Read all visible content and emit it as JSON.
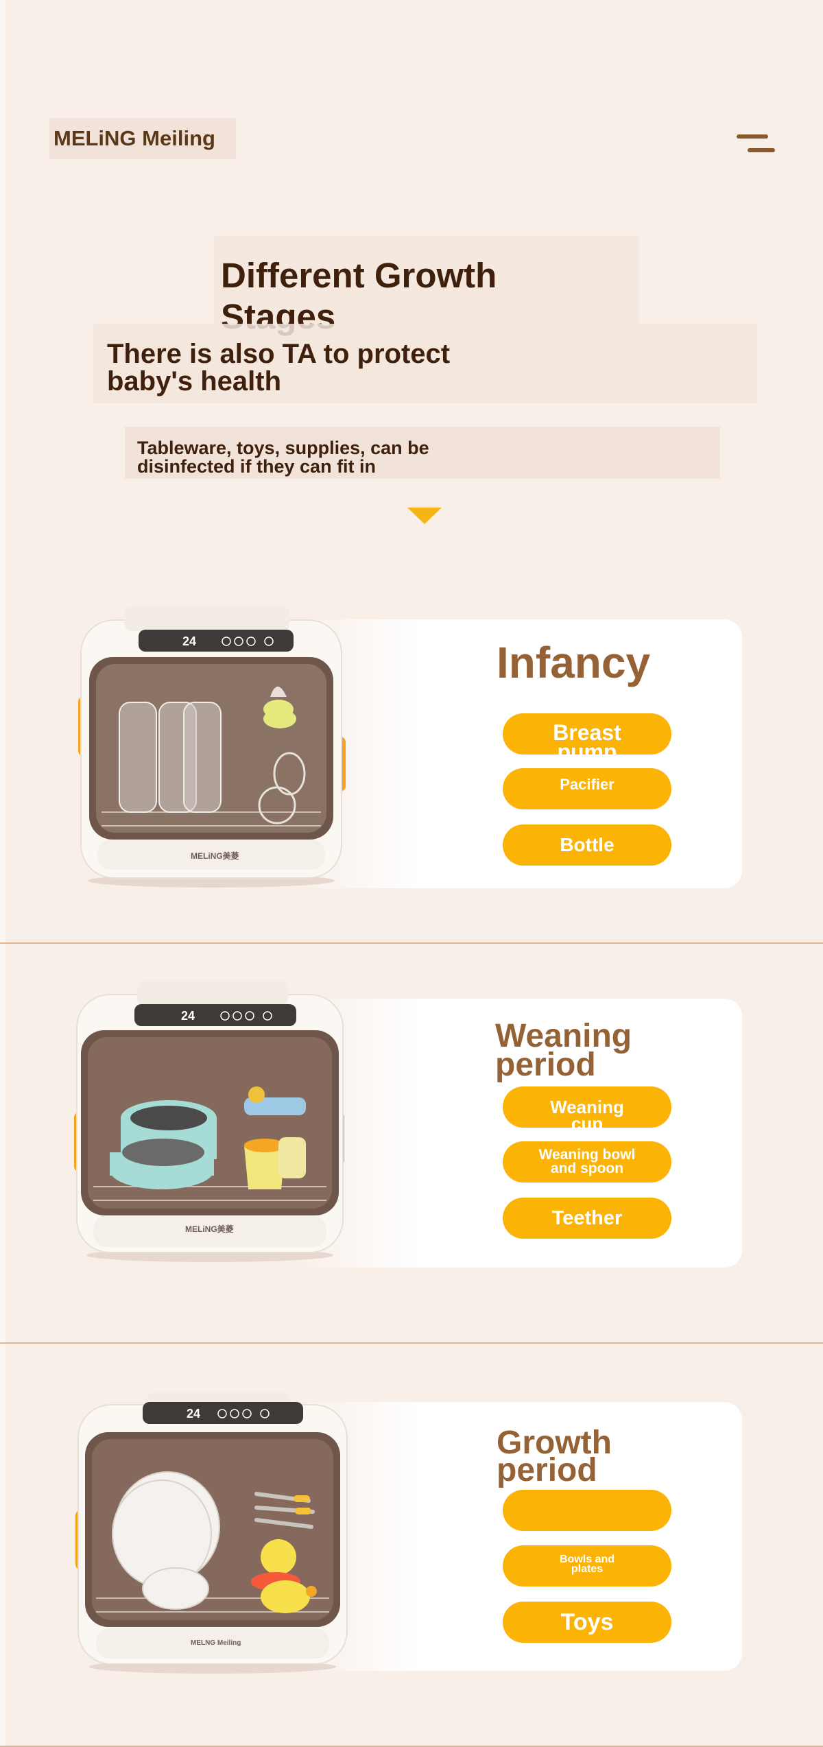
{
  "header": {
    "brand": "MELiNG Meiling",
    "menu_icon": "menu-icon"
  },
  "hero": {
    "title": "Different Growth\n Stages",
    "subtitle": "There is also TA to protect\n baby's health",
    "description": "Tableware, toys, supplies, can be\n disinfected if they can fit in",
    "arrow_icon": "caret-down-icon",
    "arrow_color": "#f5b515"
  },
  "device": {
    "display": "24",
    "brand_small": "MELiNG美菱",
    "brand_small_3": "MELNG Meiling"
  },
  "stages": [
    {
      "title": "Infancy",
      "items": [
        "Breast\npump",
        "Pacifier",
        "Bottle"
      ]
    },
    {
      "title": "Weaning\n period",
      "items": [
        "Weaning\ncup",
        "Weaning bowl\nand spoon",
        "Teether"
      ]
    },
    {
      "title": "Growth\n period",
      "items": [
        "",
        "Bowls and\nplates",
        "Toys"
      ]
    }
  ],
  "colors": {
    "accent": "#fbb306",
    "title_dark": "#3f200c",
    "stage_title": "#946235",
    "background": "#f8efe9"
  }
}
